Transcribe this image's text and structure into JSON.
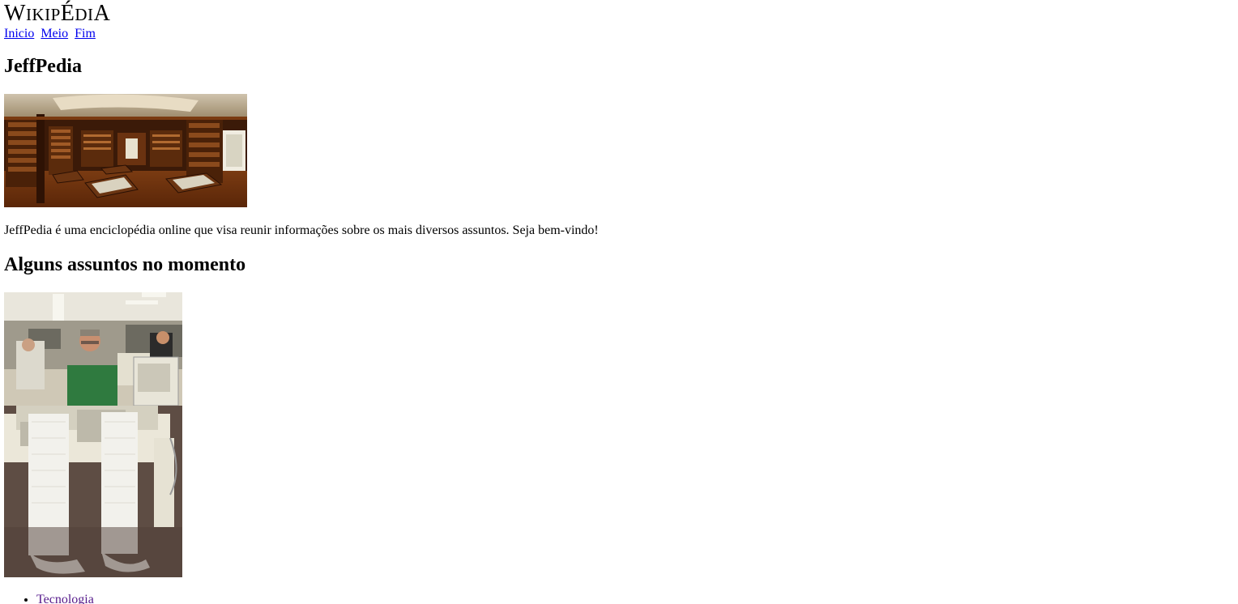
{
  "logo": {
    "text_first": "W",
    "text_small": "IKIP",
    "text_mid": "É",
    "text_small2": "DI",
    "text_last": "A"
  },
  "nav": {
    "items": [
      {
        "label": "Inicio"
      },
      {
        "label": "Meio"
      },
      {
        "label": "Fim"
      }
    ]
  },
  "main": {
    "title": "JeffPedia",
    "intro": "JeffPedia é uma enciclopédia online que visa reunir informações sobre os mais diversos assuntos. Seja bem-vindo!",
    "section_title": "Alguns assuntos no momento",
    "topics": [
      {
        "label": "Tecnologia"
      }
    ]
  },
  "colors": {
    "link": "#0000ee",
    "visited_link": "#551a8b"
  },
  "images": {
    "hero": "library-photo",
    "topic": "computer-room-photo"
  }
}
